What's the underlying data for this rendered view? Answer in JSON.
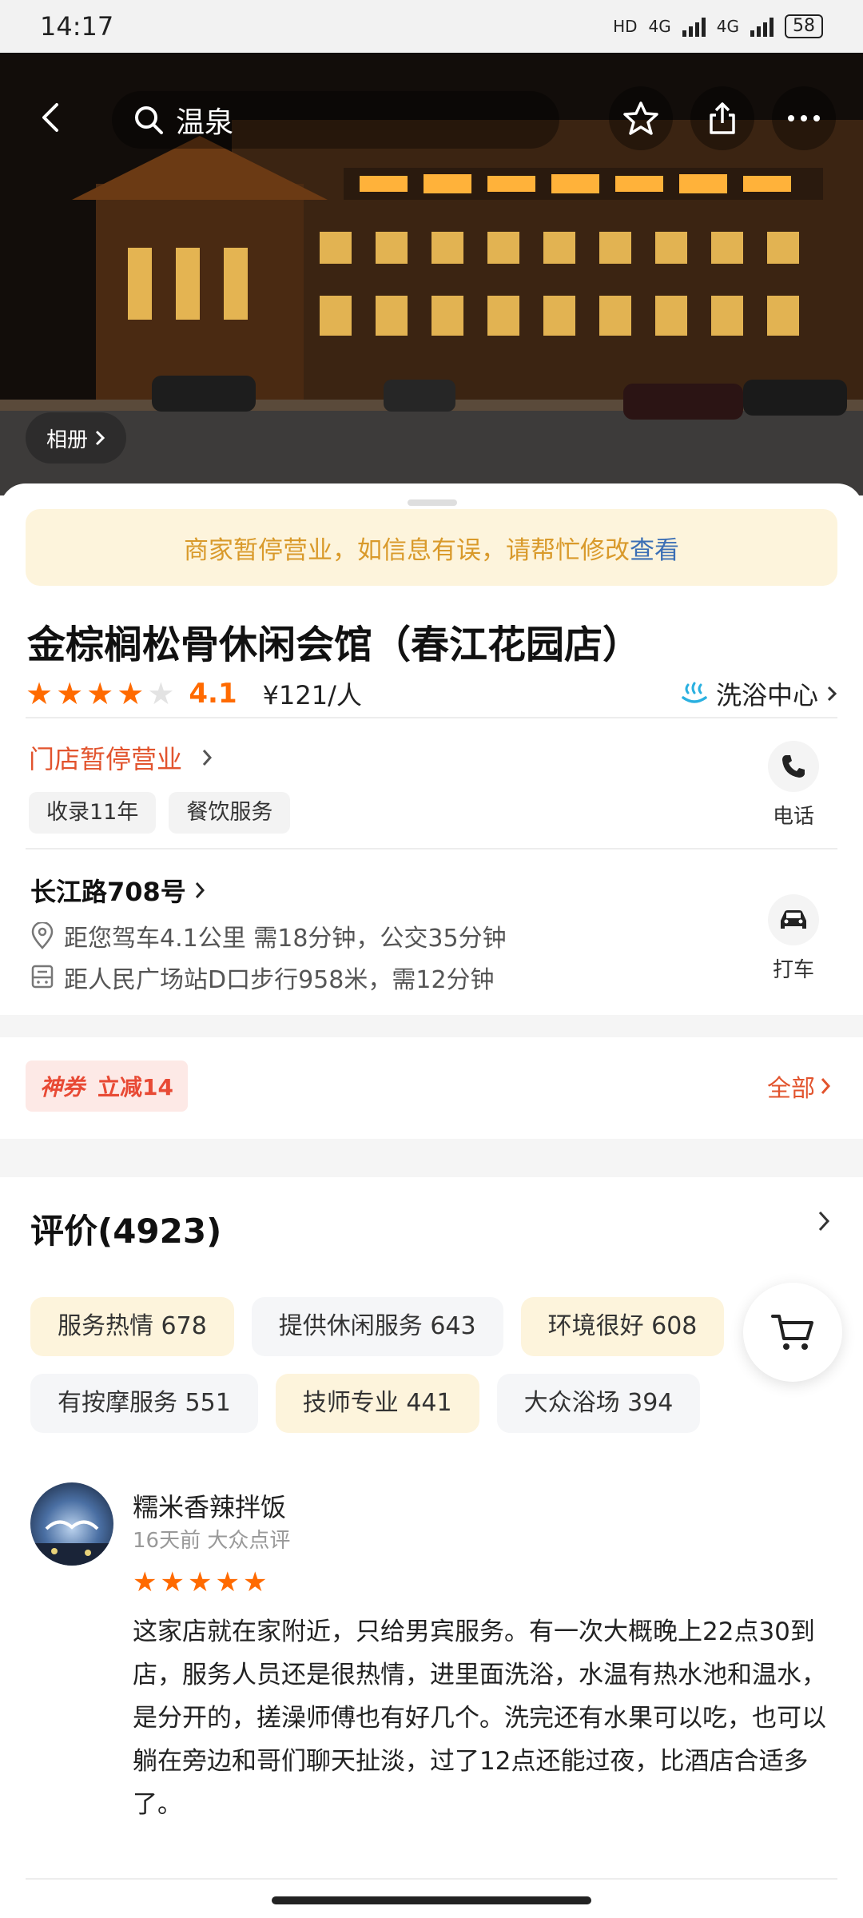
{
  "status_bar": {
    "time": "14:17",
    "network_hd": "HD",
    "network_1": "4G",
    "network_2": "4G",
    "battery": "58"
  },
  "topbar": {
    "search_text": "温泉"
  },
  "hero": {
    "album_label": "相册"
  },
  "notice": {
    "text": "商家暂停营业，如信息有误，请帮忙修改",
    "link": "查看"
  },
  "shop": {
    "name": "金棕榈松骨休闲会馆（春江花园店）",
    "rating": 4.1,
    "rating_text": "4.1",
    "price": "¥121/人",
    "category": "洗浴中心",
    "status": "门店暂停营业",
    "tags": [
      "收录11年",
      "餐饮服务"
    ],
    "phone_label": "电话",
    "address": "长江路708号",
    "drive_info": "距您驾车4.1公里 需18分钟，公交35分钟",
    "walk_info": "距人民广场站D口步行958米，需12分钟",
    "taxi_label": "打车"
  },
  "coupon": {
    "brand": "神券",
    "offer": "立减14",
    "all_label": "全部"
  },
  "reviews": {
    "title": "评价(4923)",
    "chips": [
      {
        "label": "服务热情 678",
        "style": "warm"
      },
      {
        "label": "提供休闲服务 643",
        "style": "cool"
      },
      {
        "label": "环境很好 608",
        "style": "warm"
      },
      {
        "label": "有按摩服务 551",
        "style": "cool"
      },
      {
        "label": "技师专业 441",
        "style": "warm"
      },
      {
        "label": "大众浴场 394",
        "style": "cool"
      }
    ],
    "items": [
      {
        "user": "糯米香辣拌饭",
        "meta": "16天前 大众点评",
        "stars": 5,
        "text": "这家店就在家附近，只给男宾服务。有一次大概晚上22点30到店，服务人员还是很热情，进里面洗浴，水温有热水池和温水，是分开的，搓澡师傅也有好几个。洗完还有水果可以吃，也可以躺在旁边和哥们聊天扯淡，过了12点还能过夜，比酒店合适多了。"
      }
    ]
  },
  "colors": {
    "accent": "#ff6a00",
    "warning_text": "#d99a2b",
    "link": "#3c6fb5",
    "closed": "#e2542e"
  },
  "icons": [
    "back-icon",
    "search-icon",
    "star-outline-icon",
    "share-icon",
    "more-icon",
    "chevron-right-icon",
    "hot-spring-icon",
    "phone-icon",
    "location-pin-icon",
    "transit-icon",
    "car-icon",
    "cart-icon"
  ]
}
